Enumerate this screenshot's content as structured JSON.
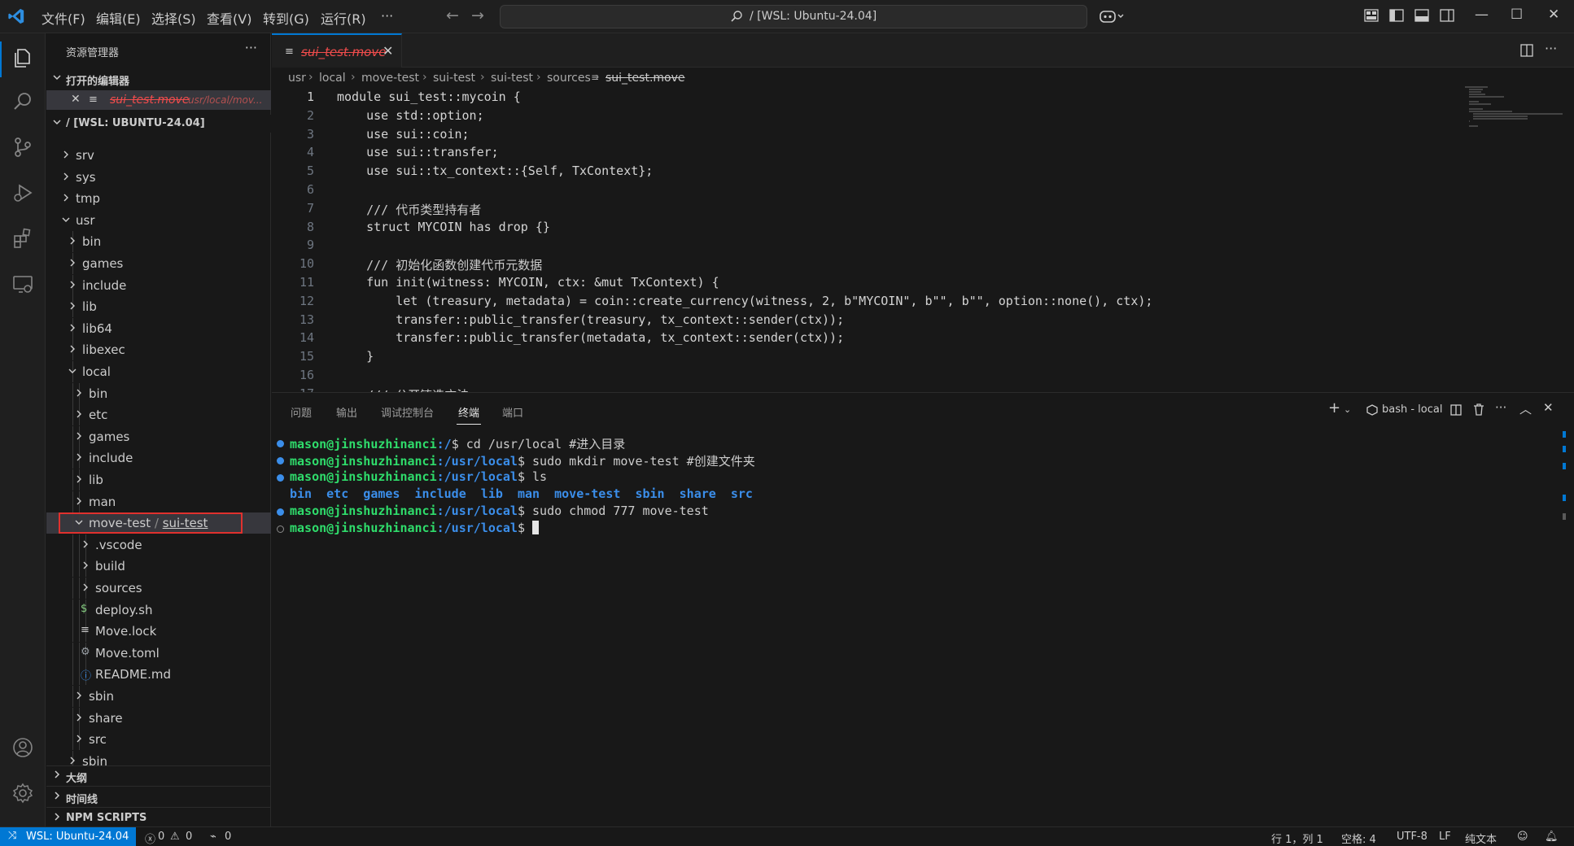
{
  "titlebar": {
    "menus": [
      "文件(F)",
      "编辑(E)",
      "选择(S)",
      "查看(V)",
      "转到(G)",
      "运行(R)",
      "···"
    ],
    "command_center": "/ [WSL: Ubuntu-24.04]"
  },
  "sidebar": {
    "title": "资源管理器",
    "more": "···",
    "open_editors_label": "打开的编辑器",
    "open_editor_file": "sui_test.move",
    "open_editor_path": "usr/local/mov...",
    "workspace_label": "/ [WSL: UBUNTU-24.04]",
    "tree": [
      {
        "label": "srv",
        "type": "folder",
        "expanded": false,
        "depth": 0
      },
      {
        "label": "sys",
        "type": "folder",
        "expanded": false,
        "depth": 0
      },
      {
        "label": "tmp",
        "type": "folder",
        "expanded": false,
        "depth": 0
      },
      {
        "label": "usr",
        "type": "folder",
        "expanded": true,
        "depth": 0
      },
      {
        "label": "bin",
        "type": "folder",
        "expanded": false,
        "depth": 1
      },
      {
        "label": "games",
        "type": "folder",
        "expanded": false,
        "depth": 1
      },
      {
        "label": "include",
        "type": "folder",
        "expanded": false,
        "depth": 1
      },
      {
        "label": "lib",
        "type": "folder",
        "expanded": false,
        "depth": 1
      },
      {
        "label": "lib64",
        "type": "folder",
        "expanded": false,
        "depth": 1
      },
      {
        "label": "libexec",
        "type": "folder",
        "expanded": false,
        "depth": 1
      },
      {
        "label": "local",
        "type": "folder",
        "expanded": true,
        "depth": 1
      },
      {
        "label": "bin",
        "type": "folder",
        "expanded": false,
        "depth": 2
      },
      {
        "label": "etc",
        "type": "folder",
        "expanded": false,
        "depth": 2
      },
      {
        "label": "games",
        "type": "folder",
        "expanded": false,
        "depth": 2
      },
      {
        "label": "include",
        "type": "folder",
        "expanded": false,
        "depth": 2
      },
      {
        "label": "lib",
        "type": "folder",
        "expanded": false,
        "depth": 2
      },
      {
        "label": "man",
        "type": "folder",
        "expanded": false,
        "depth": 2
      },
      {
        "label": "move-test",
        "label2": "sui-test",
        "type": "folder",
        "expanded": true,
        "depth": 2,
        "selected": true
      },
      {
        "label": ".vscode",
        "type": "folder",
        "expanded": false,
        "depth": 3
      },
      {
        "label": "build",
        "type": "folder",
        "expanded": false,
        "depth": 3
      },
      {
        "label": "sources",
        "type": "folder",
        "expanded": false,
        "depth": 3
      },
      {
        "label": "deploy.sh",
        "type": "file",
        "icon": "$",
        "iconColor": "#89d185",
        "depth": 3
      },
      {
        "label": "Move.lock",
        "type": "file",
        "icon": "≡",
        "iconColor": "#cccccc",
        "depth": 3
      },
      {
        "label": "Move.toml",
        "type": "file",
        "icon": "⚙",
        "iconColor": "#9aa0a6",
        "depth": 3
      },
      {
        "label": "README.md",
        "type": "file",
        "icon": "ⓘ",
        "iconColor": "#3b8eea",
        "depth": 3
      },
      {
        "label": "sbin",
        "type": "folder",
        "expanded": false,
        "depth": 2
      },
      {
        "label": "share",
        "type": "folder",
        "expanded": false,
        "depth": 2
      },
      {
        "label": "src",
        "type": "folder",
        "expanded": false,
        "depth": 2
      },
      {
        "label": "sbin",
        "type": "folder",
        "expanded": false,
        "depth": 1
      }
    ],
    "outline_label": "大纲",
    "timeline_label": "时间线",
    "npm_label": "NPM SCRIPTS"
  },
  "editor": {
    "tab_name": "sui_test.move",
    "breadcrumb": [
      "usr",
      "local",
      "move-test",
      "sui-test",
      "sui-test",
      "sources",
      "sui_test.move"
    ],
    "lines": [
      "module sui_test::mycoin {",
      "    use std::option;",
      "    use sui::coin;",
      "    use sui::transfer;",
      "    use sui::tx_context::{Self, TxContext};",
      "",
      "    /// 代币类型持有者",
      "    struct MYCOIN has drop {}",
      "",
      "    /// 初始化函数创建代币元数据",
      "    fun init(witness: MYCOIN, ctx: &mut TxContext) {",
      "        let (treasury, metadata) = coin::create_currency(witness, 2, b\"MYCOIN\", b\"\", b\"\", option::none(), ctx);",
      "        transfer::public_transfer(treasury, tx_context::sender(ctx));",
      "        transfer::public_transfer(metadata, tx_context::sender(ctx));",
      "    }",
      "",
      "    /// 公开铸造方法"
    ]
  },
  "panel": {
    "tabs": [
      "问题",
      "输出",
      "调试控制台",
      "终端",
      "端口"
    ],
    "active_tab": "终端",
    "terminal_name": "bash - local",
    "terminal_lines": [
      {
        "user": "mason@jinshuzhinanci",
        "path": ":/",
        "cmd": "$ cd /usr/local #进入目录",
        "dot": "#3b8eea"
      },
      {
        "user": "mason@jinshuzhinanci",
        "path": ":/usr/local",
        "cmd": "$ sudo mkdir move-test #创建文件夹",
        "dot": "#3b8eea"
      },
      {
        "user": "mason@jinshuzhinanci",
        "path": ":/usr/local",
        "cmd": "$ ls",
        "dot": "#3b8eea"
      },
      {
        "output": "bin  etc  games  include  lib  man  move-test  sbin  share  src"
      },
      {
        "user": "mason@jinshuzhinanci",
        "path": ":/usr/local",
        "cmd": "$ sudo chmod 777 move-test",
        "dot": "#3b8eea"
      },
      {
        "user": "mason@jinshuzhinanci",
        "path": ":/usr/local",
        "cmd": "$ ",
        "dot": "hollow",
        "cursor": true
      }
    ]
  },
  "statusbar": {
    "remote": "WSL: Ubuntu-24.04",
    "errors": "0",
    "warnings": "0",
    "ports": "0",
    "position": "行 1，列 1",
    "spaces": "空格: 4",
    "encoding": "UTF-8",
    "eol": "LF",
    "language": "纯文本"
  },
  "colors": {
    "accent": "#0078d4",
    "modified_file": "#f14c4c",
    "prompt_user": "#2fdc6b",
    "prompt_path": "#3b8eea"
  }
}
